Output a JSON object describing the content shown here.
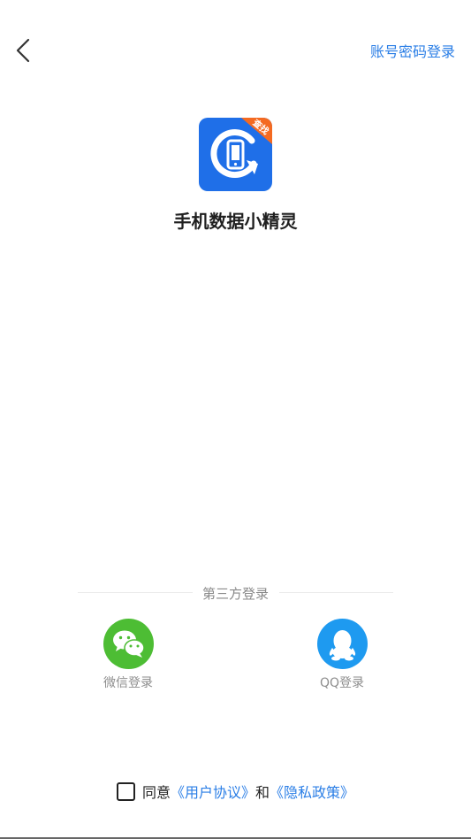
{
  "header": {
    "back_icon": "chevron-left-icon",
    "account_login_label": "账号密码登录"
  },
  "app": {
    "name": "手机数据小精灵",
    "badge_text": "查找"
  },
  "third_party": {
    "title": "第三方登录",
    "wechat_label": "微信登录",
    "qq_label": "QQ登录"
  },
  "agreement": {
    "prefix": "同意",
    "user_agreement": "《用户协议》",
    "and": "和",
    "privacy_policy": "《隐私政策》",
    "checked": false
  },
  "colors": {
    "link": "#2a7ee6",
    "wechat": "#4dbd34",
    "qq": "#1e9af0",
    "logo": "#1f6fe8",
    "badge": "#f46a21"
  }
}
